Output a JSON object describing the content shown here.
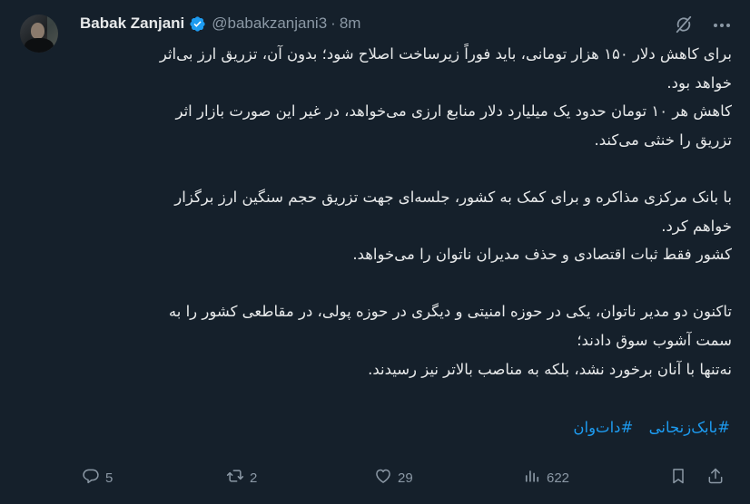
{
  "author": {
    "name": "Babak Zanjani",
    "handle": "@babakzanjani3",
    "separator": "·",
    "time": "8m"
  },
  "body_lines": [
    "برای کاهش دلار ۱۵۰ هزار تومانی، باید فوراً زیرساخت اصلاح شود؛ بدون آن، تزریق ارز بی‌اثر",
    "خواهد بود.",
    "کاهش هر ۱۰ تومان حدود یک میلیارد دلار منابع ارزی می‌خواهد، در غیر این صورت بازار اثر",
    "تزریق را خنثی می‌کند.",
    "",
    "با بانک مرکزی مذاکره و برای کمک به کشور، جلسه‌ای جهت تزریق حجم سنگین ارز برگزار",
    "خواهم کرد.",
    "کشور فقط ثبات اقتصادی و حذف مدیران ناتوان را می‌خواهد.",
    "",
    "تاکنون دو مدیر ناتوان، یکی در حوزه امنیتی و دیگری در حوزه پولی، در مقاطعی کشور را به",
    "سمت آشوب سوق دادند؛",
    "نه‌تنها با آنان برخورد نشد، بلکه به مناصب بالاتر نیز رسیدند."
  ],
  "hashtags": [
    "#بابک‌زنجانی",
    "#دات‌وان"
  ],
  "actions": {
    "replies": "5",
    "reposts": "2",
    "likes": "29",
    "views": "622"
  },
  "colors": {
    "background": "#15202b",
    "text": "#e7e9ea",
    "muted": "#8b98a5",
    "accent": "#1d9bf0"
  },
  "icons": [
    "verified-badge-icon",
    "grok-icon",
    "more-icon",
    "reply-icon",
    "repost-icon",
    "like-icon",
    "views-icon",
    "bookmark-icon",
    "share-icon"
  ]
}
